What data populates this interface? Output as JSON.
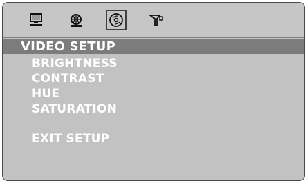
{
  "icons": [
    {
      "name": "computer-icon",
      "selected": false
    },
    {
      "name": "language-globe-icon",
      "selected": false
    },
    {
      "name": "disc-icon",
      "selected": true
    },
    {
      "name": "speaker-filter-icon",
      "selected": false
    }
  ],
  "menu": {
    "title": "VIDEO SETUP",
    "items": [
      "BRIGHTNESS",
      "CONTRAST",
      "HUE",
      "SATURATION"
    ],
    "exit_label": "EXIT SETUP"
  },
  "colors": {
    "screen_bg": "#c2c2c2",
    "title_bar_bg": "#7c7c7c",
    "text": "#ffffff"
  }
}
